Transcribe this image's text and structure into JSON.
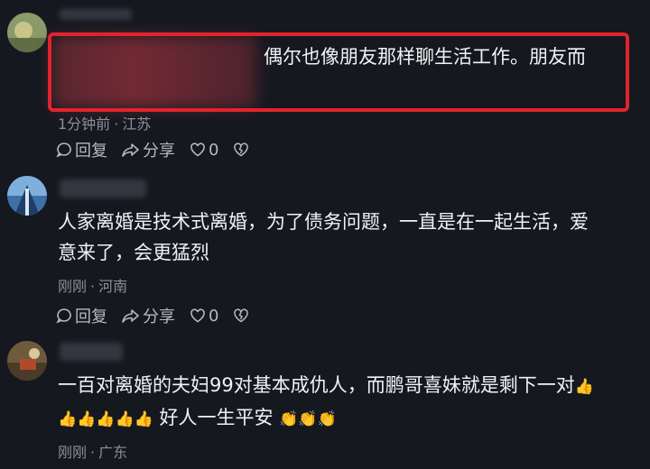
{
  "comments": [
    {
      "text": "偶尔也像朋友那样聊生活工作。朋友而",
      "time": "1分钟前",
      "location": "江苏",
      "reply_label": "回复",
      "share_label": "分享",
      "like_count": "0"
    },
    {
      "text_line1": "人家离婚是技术式离婚，为了债务问题，一直是在一起生活，爱",
      "text_line2": "意来了，会更猛烈",
      "time": "刚刚",
      "location": "河南",
      "reply_label": "回复",
      "share_label": "分享",
      "like_count": "0"
    },
    {
      "text_line1": "一百对离婚的夫妇99对基本成仇人，而鹏哥喜妹就是剩下一对",
      "text_line2_emoji_before": "👍👍👍👍👍",
      "text_line2": "好人一生平安",
      "text_line2_emoji_after": "👏👏👏",
      "time": "刚刚",
      "location": "广东"
    }
  ],
  "colors": {
    "background": "#16181f",
    "highlight_border": "#e3232b",
    "meta_text": "#8c8f99"
  },
  "icons": [
    "reply-bubble-icon",
    "share-arrow-icon",
    "heart-icon",
    "broken-heart-icon",
    "thumbs-up-emoji",
    "clap-emoji"
  ]
}
